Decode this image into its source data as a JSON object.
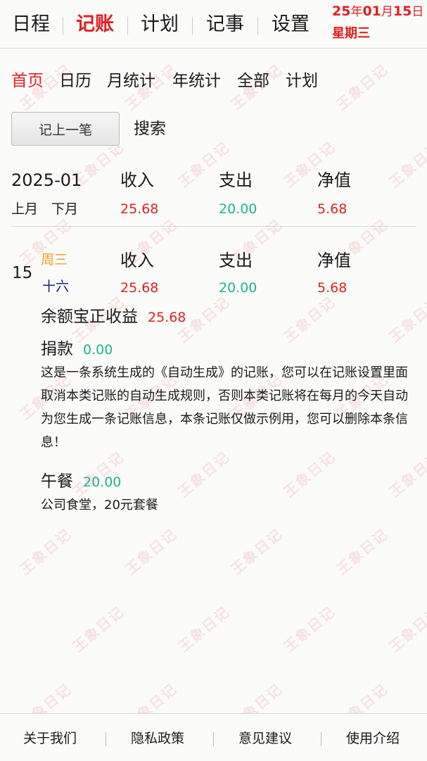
{
  "app": {
    "watermark": "王象日记"
  },
  "topnav": {
    "items": [
      {
        "label": "日程",
        "active": false
      },
      {
        "label": "记账",
        "active": true
      },
      {
        "label": "计划",
        "active": false
      },
      {
        "label": "记事",
        "active": false
      },
      {
        "label": "设置",
        "active": false
      }
    ],
    "date": {
      "year": "25",
      "year_unit": "年",
      "month": "01",
      "month_unit": "月",
      "day": "15",
      "day_unit": "日",
      "weekday": "星期三"
    }
  },
  "subnav": {
    "items": [
      {
        "label": "首页",
        "active": true
      },
      {
        "label": "日历",
        "active": false
      },
      {
        "label": "月统计",
        "active": false
      },
      {
        "label": "年统计",
        "active": false
      },
      {
        "label": "全部",
        "active": false
      },
      {
        "label": "计划",
        "active": false
      }
    ]
  },
  "actions": {
    "record_button": "记上一笔",
    "search_link": "搜索"
  },
  "month_summary": {
    "period": "2025-01",
    "prev_month": "上月",
    "next_month": "下月",
    "income_label": "收入",
    "expense_label": "支出",
    "net_label": "净值",
    "income": "25.68",
    "expense": "20.00",
    "net": "5.68"
  },
  "day_summary": {
    "day": "15",
    "weekday": "周三",
    "lunar": "十六",
    "income_label": "收入",
    "expense_label": "支出",
    "net_label": "净值",
    "income": "25.68",
    "expense": "20.00",
    "net": "5.68"
  },
  "entries": [
    {
      "title": "余额宝正收益",
      "amount": "25.68",
      "type": "income",
      "desc": ""
    },
    {
      "title": "捐款",
      "amount": "0.00",
      "type": "expense",
      "desc": "这是一条系统生成的《自动生成》的记账，您可以在记账设置里面取消本类记账的自动生成规则，否则本类记账将在每月的今天自动为您生成一条记账信息，本条记账仅做示例用，您可以删除本条信息！"
    },
    {
      "title": "午餐",
      "amount": "20.00",
      "type": "expense",
      "desc": "公司食堂，20元套餐"
    }
  ],
  "footer": {
    "items": [
      "关于我们",
      "隐私政策",
      "意见建议",
      "使用介绍"
    ]
  },
  "colors": {
    "accent_red": "#e02020",
    "expense_green": "#22b28e",
    "weekday_orange": "#f0a020",
    "lunar_navy": "#1a237e"
  }
}
